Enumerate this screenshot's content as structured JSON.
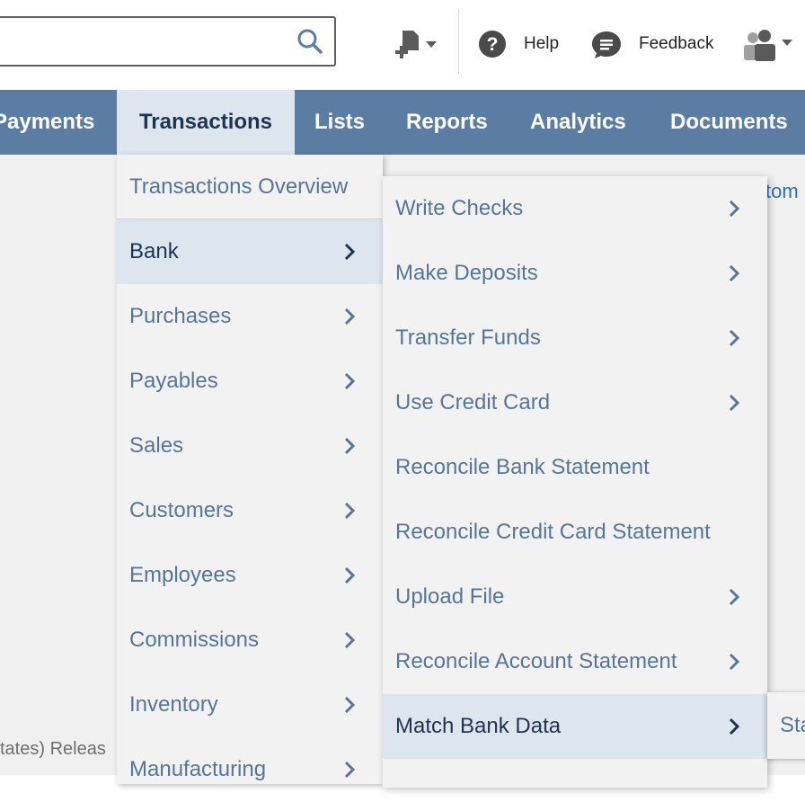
{
  "header": {
    "search": {
      "icon": "search-icon"
    },
    "create": {
      "icon": "create-new-icon"
    },
    "help": {
      "icon": "question-circle-icon",
      "label": "Help"
    },
    "feedback": {
      "icon": "speech-bubble-icon",
      "label": "Feedback"
    },
    "user": {
      "icon": "users-icon"
    }
  },
  "navbar": {
    "items": [
      {
        "label": "Payments",
        "active": false
      },
      {
        "label": "Transactions",
        "active": true
      },
      {
        "label": "Lists",
        "active": false
      },
      {
        "label": "Reports",
        "active": false
      },
      {
        "label": "Analytics",
        "active": false
      },
      {
        "label": "Documents",
        "active": false
      }
    ]
  },
  "background": {
    "partial_link": "tom",
    "footer_text": "tates) Releas"
  },
  "menu_level1": {
    "items": [
      {
        "label": "Transactions Overview",
        "has_submenu": false
      },
      {
        "label": "Bank",
        "has_submenu": true,
        "selected": true
      },
      {
        "label": "Purchases",
        "has_submenu": true
      },
      {
        "label": "Payables",
        "has_submenu": true
      },
      {
        "label": "Sales",
        "has_submenu": true
      },
      {
        "label": "Customers",
        "has_submenu": true
      },
      {
        "label": "Employees",
        "has_submenu": true
      },
      {
        "label": "Commissions",
        "has_submenu": true
      },
      {
        "label": "Inventory",
        "has_submenu": true
      },
      {
        "label": "Manufacturing",
        "has_submenu": true
      }
    ]
  },
  "menu_level2": {
    "items": [
      {
        "label": "Write Checks",
        "has_submenu": true
      },
      {
        "label": "Make Deposits",
        "has_submenu": true
      },
      {
        "label": "Transfer Funds",
        "has_submenu": true
      },
      {
        "label": "Use Credit Card",
        "has_submenu": true
      },
      {
        "label": "Reconcile Bank Statement",
        "has_submenu": false
      },
      {
        "label": "Reconcile Credit Card Statement",
        "has_submenu": false
      },
      {
        "label": "Upload File",
        "has_submenu": true
      },
      {
        "label": "Reconcile Account Statement",
        "has_submenu": true
      },
      {
        "label": "Match Bank Data",
        "has_submenu": true,
        "selected": true
      }
    ]
  },
  "menu_level3": {
    "items": [
      {
        "label": "Sta"
      }
    ]
  },
  "colors": {
    "navbar": "#5b7da3",
    "menu_text": "#567699",
    "selected_bg": "#dde5ee",
    "selected_text": "#1d3553"
  }
}
